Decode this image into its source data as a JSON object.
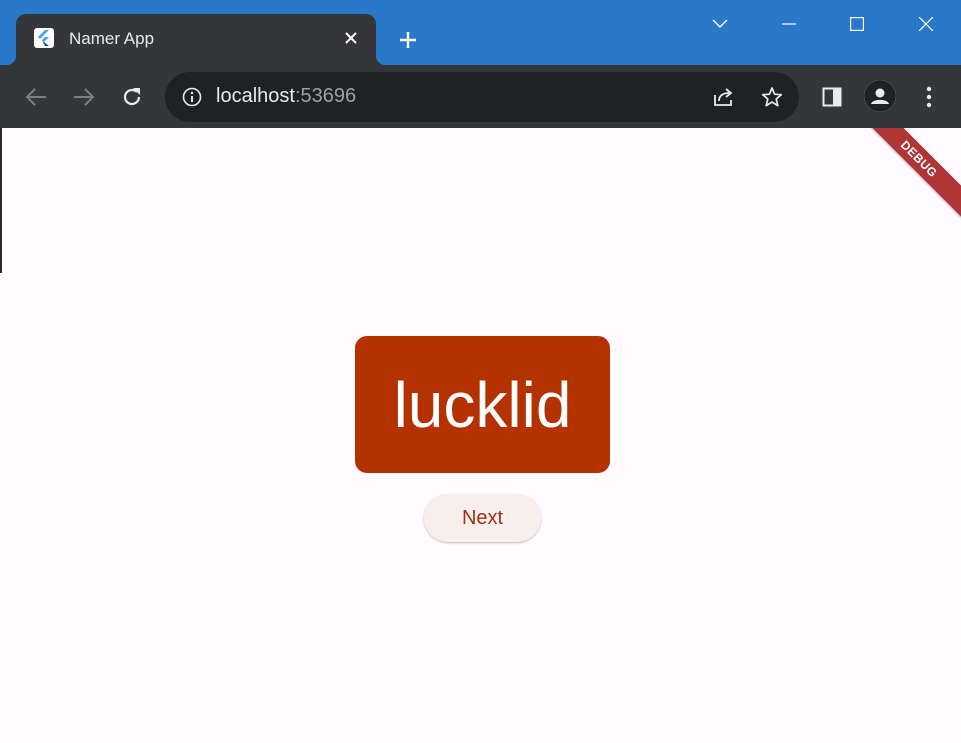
{
  "browser": {
    "tab": {
      "title": "Namer App",
      "favicon": "flutter-logo-icon"
    },
    "address": {
      "host": "localhost",
      "port": ":53696"
    },
    "icons": {
      "back": "arrow-left-icon",
      "forward": "arrow-right-icon",
      "reload": "reload-icon",
      "site_info": "info-icon",
      "share": "share-icon",
      "bookmark": "star-icon",
      "side_panel": "side-panel-icon",
      "profile": "person-icon",
      "menu": "kebab-menu-icon"
    },
    "colors": {
      "titlebar": "#2a78c9",
      "toolbar": "#35363a",
      "omnibox": "#202124"
    }
  },
  "app": {
    "debug_banner": "DEBUG",
    "word": "lucklid",
    "next_label": "Next",
    "colors": {
      "card": "#b33200",
      "button_bg": "#f8efec",
      "button_text": "#9c3316",
      "page_bg": "#fffbfe"
    }
  }
}
